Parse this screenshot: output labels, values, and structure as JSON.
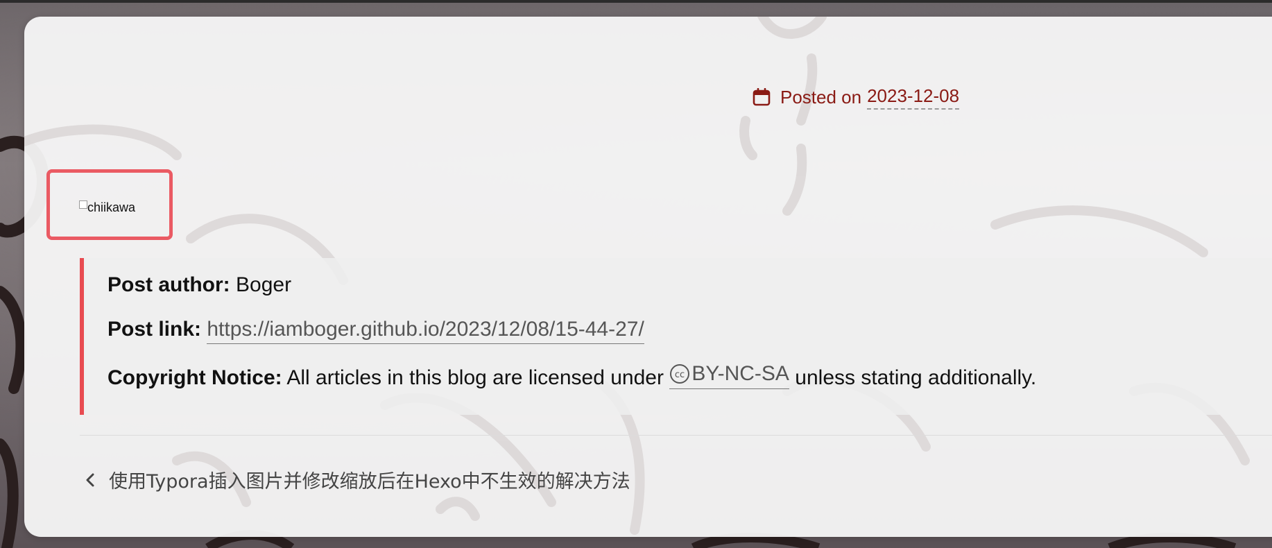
{
  "meta": {
    "posted_label": "Posted on",
    "posted_date": "2023-12-08"
  },
  "image": {
    "alt_text": "chiikawa"
  },
  "copyright": {
    "author_label": "Post author:",
    "author_value": "Boger",
    "link_label": "Post link:",
    "link_value": "https://iamboger.github.io/2023/12/08/15-44-27/",
    "notice_label": "Copyright Notice:",
    "notice_text_before": "All articles in this blog are licensed under",
    "license_label": "BY-NC-SA",
    "notice_text_after": "unless stating additionally."
  },
  "navigation": {
    "prev_post_title": "使用Typora插入图片并修改缩放后在Hexo中不生效的解决方法"
  },
  "icons": {
    "calendar": "calendar-icon",
    "creative_commons": "creative-commons-icon",
    "chevron_left": "chevron-left-icon",
    "broken_image": "broken-image-icon"
  },
  "colors": {
    "accent_red": "#8a1a14",
    "highlight_border": "#ea5a63",
    "copyright_bar": "#e84b51"
  }
}
